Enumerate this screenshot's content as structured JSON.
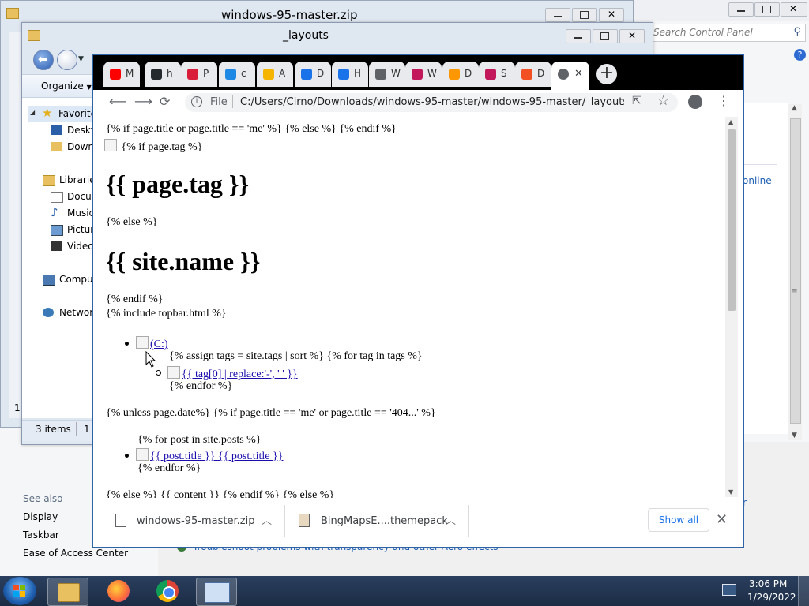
{
  "control_panel": {
    "search_placeholder": "Search Control Panel",
    "online_link": "online",
    "see_also": {
      "heading": "See also",
      "items": [
        "Display",
        "Taskbar",
        "Ease of Access Center"
      ]
    },
    "troubleshoot_link": "Troubleshoot problems with transparency and other Aero effects",
    "status_left": "1",
    "r_fragment": "r"
  },
  "explorer": {
    "window_title_zip": "windows-95-master.zip",
    "window_title": "_layouts",
    "organize_label": "Organize",
    "nav": {
      "favorites": "Favorites",
      "desktop": "Desktop",
      "downloads": "Downloads",
      "libraries": "Libraries",
      "documents": "Documents",
      "music": "Music",
      "pictures": "Pictures",
      "videos": "Videos",
      "computer": "Computer",
      "network": "Network"
    },
    "status": {
      "items": "3 items",
      "selected": "1"
    }
  },
  "chrome": {
    "tabs": [
      {
        "letter": "M",
        "icon": "youtube-icon",
        "color": "#ff0000"
      },
      {
        "letter": "h",
        "icon": "github-icon",
        "color": "#24292e"
      },
      {
        "letter": "P",
        "icon": "lips-icon",
        "color": "#d91c3a"
      },
      {
        "letter": "c",
        "icon": "bing-icon",
        "color": "#1e88e5"
      },
      {
        "letter": "A",
        "icon": "pinwheel-icon",
        "color": "#f4b400"
      },
      {
        "letter": "D",
        "icon": "download-icon",
        "color": "#1a73e8"
      },
      {
        "letter": "H",
        "icon": "history-icon",
        "color": "#1a73e8"
      },
      {
        "letter": "W",
        "icon": "globe-icon",
        "color": "#5f6368"
      },
      {
        "letter": "W",
        "icon": "sp-icon",
        "color": "#c2185b"
      },
      {
        "letter": "D",
        "icon": "swirl-icon",
        "color": "#ff9800"
      },
      {
        "letter": "S",
        "icon": "sp-icon",
        "color": "#c2185b"
      },
      {
        "letter": "D",
        "icon": "windows-icon",
        "color": "#f25022"
      }
    ],
    "active_tab_icon": "globe-icon",
    "address": {
      "scheme_label": "File",
      "url": "C:/Users/Cirno/Downloads/windows-95-master/windows-95-master/_layouts..."
    },
    "content": {
      "line1": "{% if page.title or page.title == 'me' %} {% else %} {% endif %}",
      "line2": "{% if page.tag %}",
      "heading1": "{{ page.tag }}",
      "line3": "{% else %}",
      "heading2": "{{ site.name }}",
      "line4": "{% endif %}",
      "line5": "{% include topbar.html %}",
      "link_c": "(C:)",
      "line6": "{% assign tags = site.tags | sort %} {% for tag in tags %}",
      "link_tag": "{{ tag[0] | replace:'-', ' ' }}",
      "line7": "{% endfor %}",
      "line8": "{% unless page.date%} {% if page.title == 'me' or page.title == '404...' %}",
      "line9": "{% for post in site.posts %}",
      "link_post": "{{ post.title }} {{ post.title }}",
      "line10": "{% endfor %}",
      "line11": "{% else %} {{ content }} {% endif %} {% else %}"
    },
    "downloads": {
      "items": [
        {
          "name": "windows-95-master.zip"
        },
        {
          "name": "BingMapsE....themepack"
        }
      ],
      "show_all": "Show all"
    }
  },
  "taskbar": {
    "time": "3:06 PM",
    "date": "1/29/2022"
  }
}
